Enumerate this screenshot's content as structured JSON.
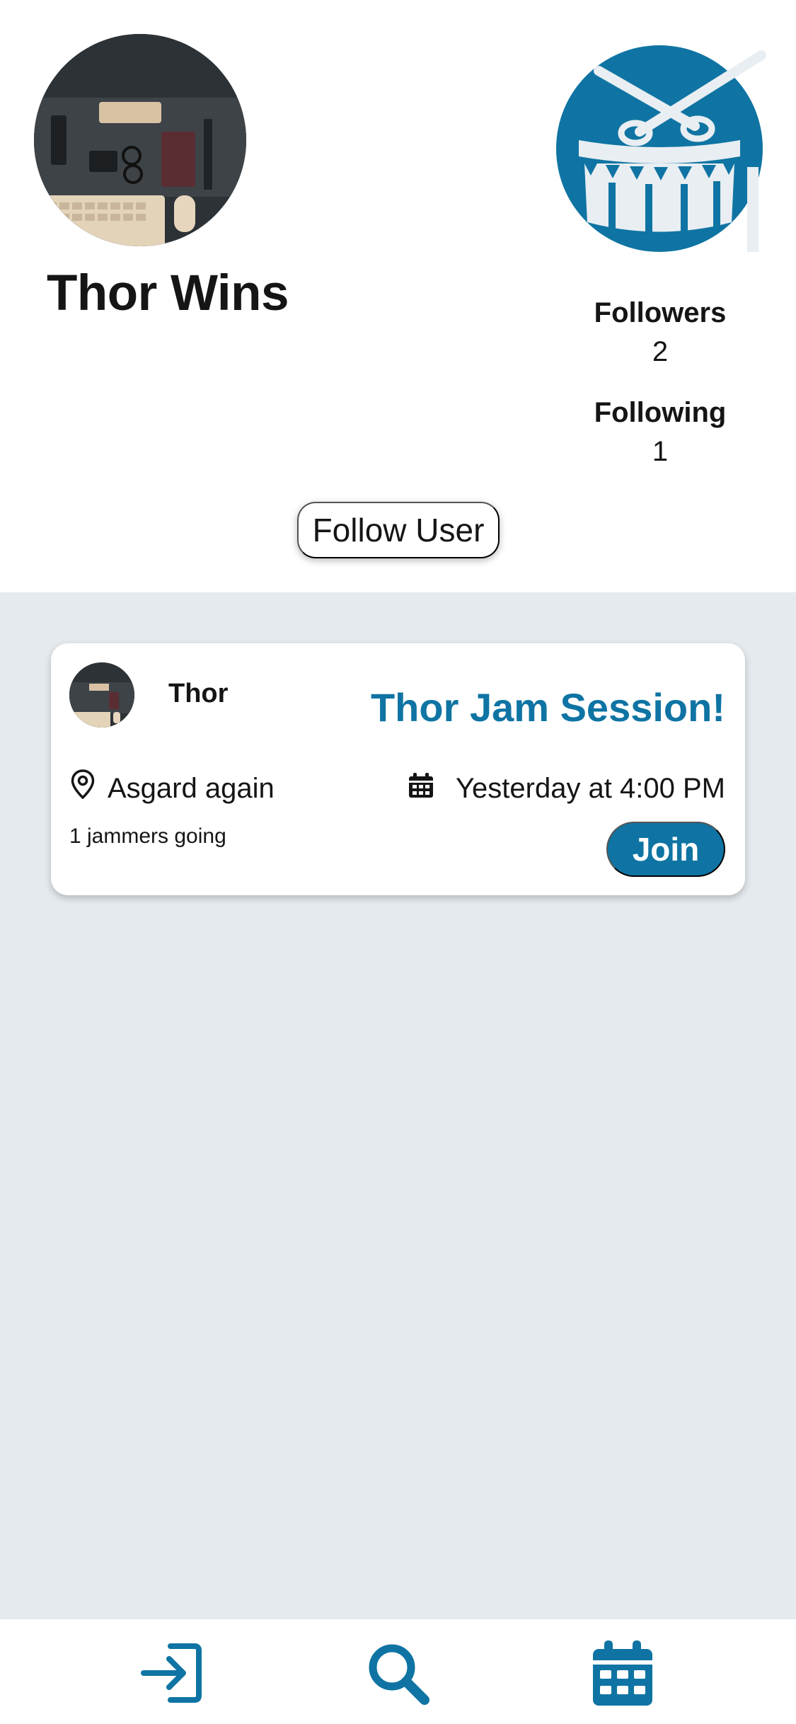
{
  "profile": {
    "name": "Thor Wins",
    "followers_label": "Followers",
    "followers_count": "2",
    "following_label": "Following",
    "following_count": "1",
    "follow_button": "Follow User",
    "instrument_icon": "drum-icon"
  },
  "events": [
    {
      "host_name": "Thor",
      "title": "Thor Jam Session!",
      "location": "Asgard again",
      "date": "Yesterday at 4:00 PM",
      "attendees": "1 jammers going",
      "join_label": "Join"
    }
  ],
  "tab_bar": {
    "items": [
      {
        "icon": "login-icon"
      },
      {
        "icon": "search-icon"
      },
      {
        "icon": "calendar-icon"
      }
    ]
  },
  "colors": {
    "accent": "#0f74a3",
    "background": "#e5eaee",
    "surface": "#ffffff",
    "text": "#151515"
  }
}
